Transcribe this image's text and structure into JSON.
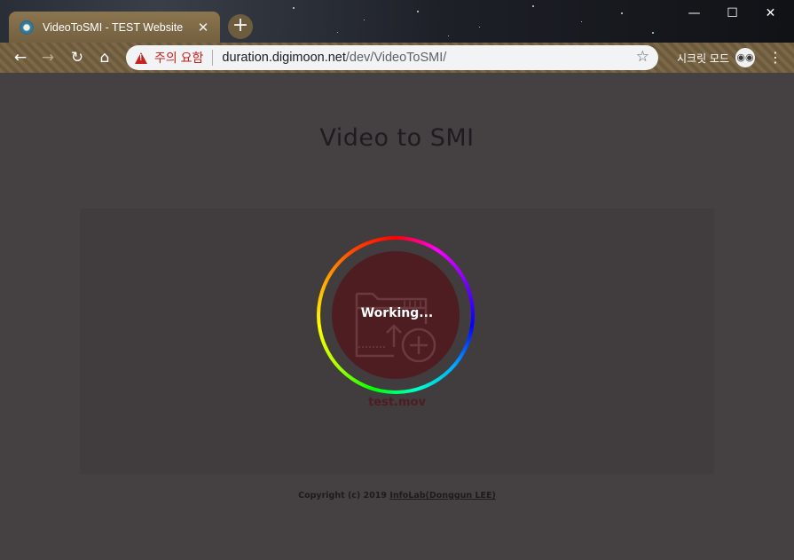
{
  "browser": {
    "tab_title": "VideoToSMI - TEST Website",
    "security_warning": "주의 요함",
    "url_host": "duration.digimoon.net",
    "url_path": "/dev/VideoToSMI/",
    "incognito_label": "시크릿 모드"
  },
  "page": {
    "title": "Video to SMI",
    "status": "Working...",
    "filename": "test.mov",
    "footer_prefix": "Copyright (c) 2019",
    "footer_link": "InfoLab(Donggun LEE)"
  },
  "colors": {
    "background": "#454142",
    "panel": "#413c3d",
    "upload_circle": "#4e1d22"
  }
}
